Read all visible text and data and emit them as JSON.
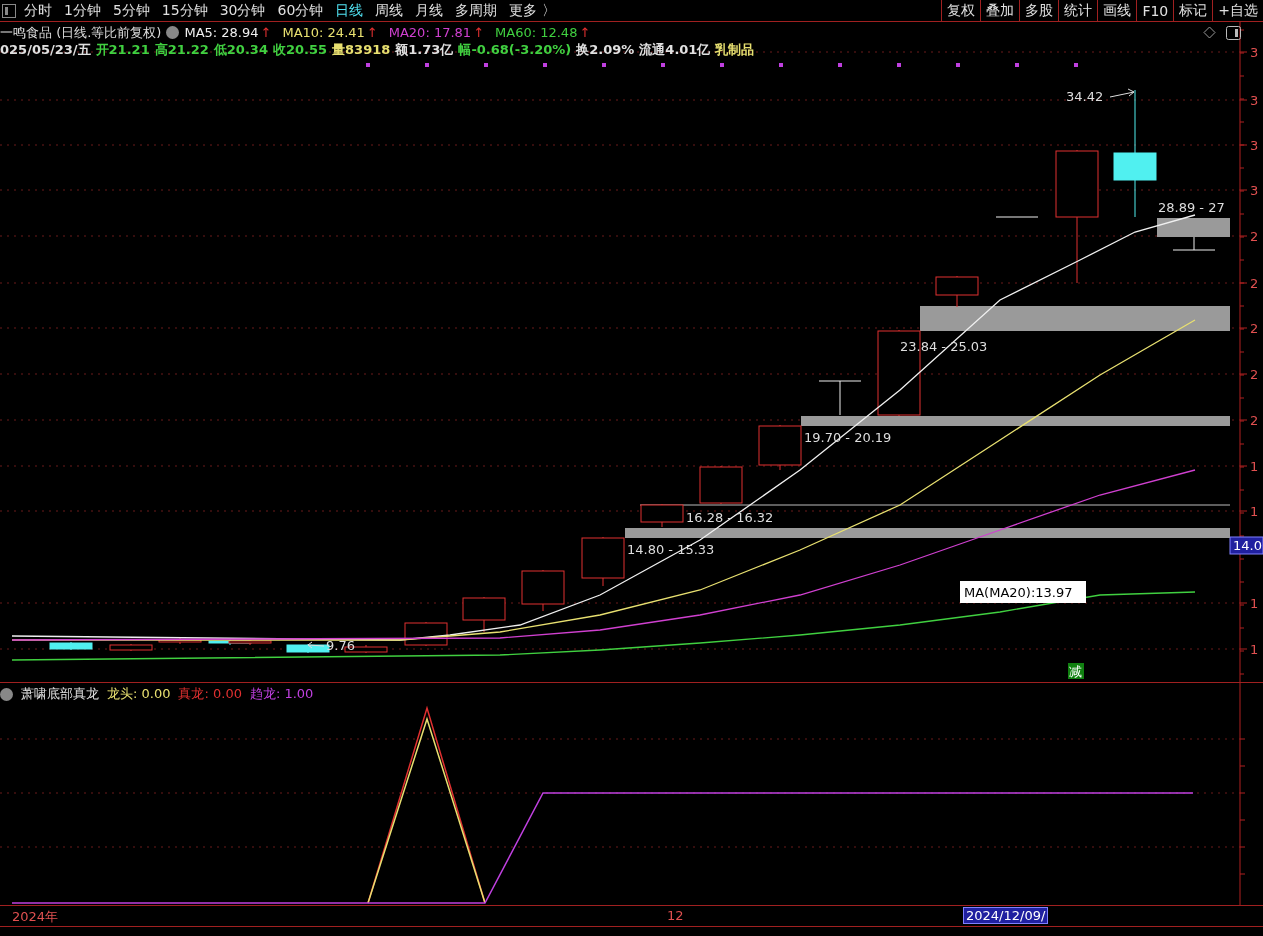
{
  "toolbar": {
    "periods": [
      {
        "label": "分时",
        "selected": false
      },
      {
        "label": "1分钟",
        "selected": false
      },
      {
        "label": "5分钟",
        "selected": false
      },
      {
        "label": "15分钟",
        "selected": false
      },
      {
        "label": "30分钟",
        "selected": false
      },
      {
        "label": "60分钟",
        "selected": false
      },
      {
        "label": "日线",
        "selected": true
      },
      {
        "label": "周线",
        "selected": false
      },
      {
        "label": "月线",
        "selected": false
      },
      {
        "label": "多周期",
        "selected": false
      },
      {
        "label": "更多 〉",
        "selected": false
      }
    ],
    "actions": [
      "复权",
      "叠加",
      "多股",
      "统计",
      "画线",
      "F10",
      "标记",
      "+自选"
    ]
  },
  "quote": {
    "title": "一鸣食品 (日线.等比前复权)",
    "moving_averages": [
      {
        "label": "MA5: 28.94",
        "arrow": "↑",
        "color": "#f0f0f0"
      },
      {
        "label": "MA10: 24.41",
        "arrow": "↑",
        "color": "#e8e070"
      },
      {
        "label": "MA20: 17.81",
        "arrow": "↑",
        "color": "#d040d0"
      },
      {
        "label": "MA60: 12.48",
        "arrow": "↑",
        "color": "#40d040"
      }
    ],
    "fields": [
      {
        "text": "025/05/23/五",
        "color": "#e0e0e0"
      },
      {
        "text": "开21.21",
        "color": "#40d040"
      },
      {
        "text": "高21.22",
        "color": "#40d040"
      },
      {
        "text": "低20.34",
        "color": "#40d040"
      },
      {
        "text": "收20.55",
        "color": "#40d040"
      },
      {
        "text": "量83918",
        "color": "#e8e070"
      },
      {
        "text": "额1.73亿",
        "color": "#e0e0e0"
      },
      {
        "text": "幅-0.68(-3.20%)",
        "color": "#40d040"
      },
      {
        "text": "换2.09%",
        "color": "#e0e0e0"
      },
      {
        "text": "流通4.01亿",
        "color": "#e0e0e0"
      },
      {
        "text": "乳制品",
        "color": "#e8e070"
      }
    ]
  },
  "chart": {
    "annotations": [
      "34.42",
      "28.89 - 27",
      "23.84 - 25.03",
      "19.70 - 20.19",
      "16.28 - 16.32",
      "14.80 - 15.33"
    ],
    "ma_label": "MA(MA20):13.97",
    "low_label": "9.76",
    "signal": "减"
  },
  "price_axis": {
    "labels": [
      "3",
      "3",
      "3",
      "3",
      "2",
      "2",
      "2",
      "2",
      "2",
      "1",
      "1",
      "1",
      "1"
    ],
    "current_price": "14.0"
  },
  "indicator": {
    "name": "萧啸底部真龙",
    "values": [
      {
        "label": "龙头:",
        "value": "0.00",
        "color": "#e8e070"
      },
      {
        "label": "真龙:",
        "value": "0.00",
        "color": "#e03030"
      },
      {
        "label": "趋龙:",
        "value": "1.00",
        "color": "#c040e0"
      }
    ]
  },
  "time_axis": {
    "labels": [
      "2024年",
      "12"
    ],
    "cursor_date": "2024/12/09/"
  }
}
